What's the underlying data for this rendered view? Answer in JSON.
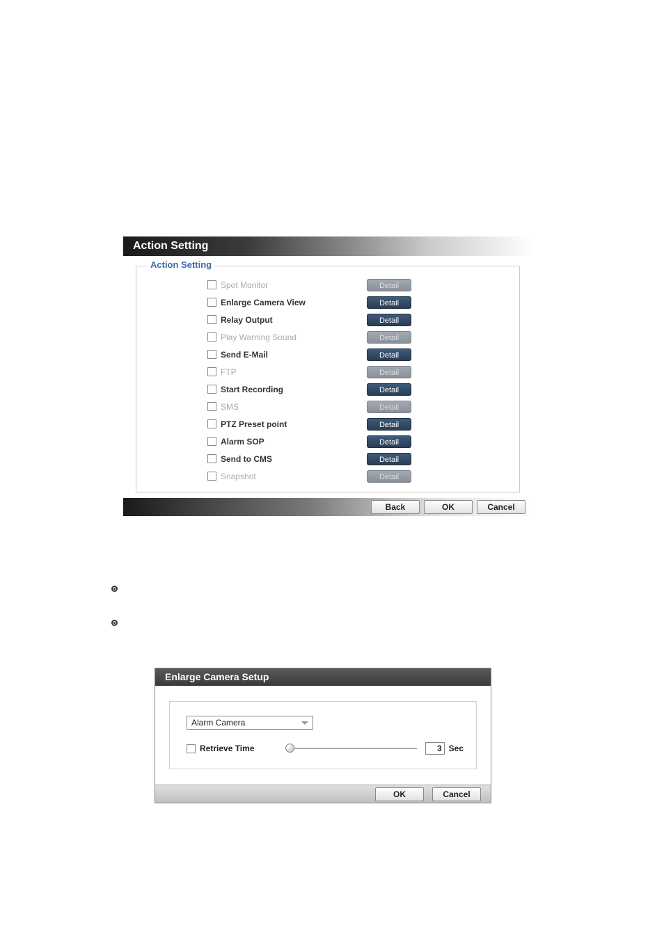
{
  "panel1": {
    "title": "Action Setting",
    "legend": "Action Setting",
    "rows": [
      {
        "label": "Spot Monitor",
        "disabled": true,
        "detail_enabled": false,
        "detail": "Detail"
      },
      {
        "label": "Enlarge Camera View",
        "disabled": false,
        "detail_enabled": true,
        "detail": "Detail"
      },
      {
        "label": "Relay Output",
        "disabled": false,
        "detail_enabled": true,
        "detail": "Detail"
      },
      {
        "label": "Play Warning Sound",
        "disabled": true,
        "detail_enabled": false,
        "detail": "Detail"
      },
      {
        "label": "Send E-Mail",
        "disabled": false,
        "detail_enabled": true,
        "detail": "Detail"
      },
      {
        "label": "FTP",
        "disabled": true,
        "detail_enabled": false,
        "detail": "Detail"
      },
      {
        "label": "Start Recording",
        "disabled": false,
        "detail_enabled": true,
        "detail": "Detail"
      },
      {
        "label": "SMS",
        "disabled": true,
        "detail_enabled": false,
        "detail": "Detail"
      },
      {
        "label": "PTZ Preset point",
        "disabled": false,
        "detail_enabled": true,
        "detail": "Detail"
      },
      {
        "label": "Alarm SOP",
        "disabled": false,
        "detail_enabled": true,
        "detail": "Detail"
      },
      {
        "label": "Send to CMS",
        "disabled": false,
        "detail_enabled": true,
        "detail": "Detail"
      },
      {
        "label": "Snapshot",
        "disabled": true,
        "detail_enabled": false,
        "detail": "Detail"
      }
    ],
    "back": "Back",
    "ok": "OK",
    "cancel": "Cancel"
  },
  "panel2": {
    "title": "Enlarge Camera Setup",
    "dropdown_value": "Alarm Camera",
    "retrieve_label": "Retrieve Time",
    "slider_value": "3",
    "sec": "Sec",
    "ok": "OK",
    "cancel": "Cancel"
  }
}
